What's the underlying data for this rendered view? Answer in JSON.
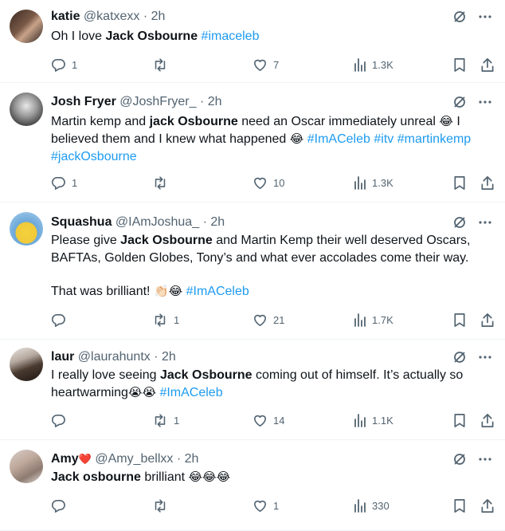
{
  "tweets": [
    {
      "name": "katie",
      "heart": "",
      "handle": "@katxexx",
      "sep": "·",
      "time": "2h",
      "text_a": "Oh I love ",
      "bold_a": "Jack Osbourne",
      "text_b": " ",
      "tags_a": "#imaceleb",
      "replies": "1",
      "reposts": "",
      "likes": "7",
      "views": "1.3K"
    },
    {
      "name": "Josh Fryer",
      "heart": "",
      "handle": "@JoshFryer_",
      "sep": "·",
      "time": "2h",
      "text_a": "Martin kemp and ",
      "bold_a": "jack Osbourne",
      "text_b": " need an Oscar immediately unreal ",
      "emoji_a": "😂",
      "text_c": " I believed them and I knew what happened ",
      "emoji_b": "😂",
      "tags_a": "#ImACeleb",
      "tags_b": "#itv",
      "tags_c": "#martinkemp",
      "tags_d": "#jackOsbourne",
      "replies": "1",
      "reposts": "",
      "likes": "10",
      "views": "1.3K"
    },
    {
      "name": "Squashua",
      "heart": "",
      "handle": "@IAmJoshua_",
      "sep": "·",
      "time": "2h",
      "text_a": "Please give ",
      "bold_a": "Jack Osbourne",
      "text_b": " and Martin Kemp their well deserved Oscars, BAFTAs, Golden Globes, Tony’s and what ever accolades come their way.",
      "text_c": "That was brilliant! ",
      "emoji_a": "👏🏻😂",
      "tags_a": "#ImACeleb",
      "replies": "",
      "reposts": "1",
      "likes": "21",
      "views": "1.7K"
    },
    {
      "name": "laur",
      "heart": "",
      "handle": "@laurahuntx",
      "sep": "·",
      "time": "2h",
      "text_a": "I really love seeing ",
      "bold_a": "Jack Osbourne",
      "text_b": " coming out of himself. It’s actually so heartwarming",
      "emoji_a": "😭😭",
      "tags_a": "#ImACeleb",
      "replies": "",
      "reposts": "1",
      "likes": "14",
      "views": "1.1K"
    },
    {
      "name": "Amy",
      "heart": "❤️",
      "handle": "@Amy_bellxx",
      "sep": "·",
      "time": "2h",
      "bold_a": "Jack osbourne",
      "text_b": " brilliant ",
      "emoji_a": "😂😂😂",
      "replies": "",
      "reposts": "",
      "likes": "1",
      "views": "330"
    }
  ],
  "icons": {
    "grok": "grok-icon",
    "more": "more-icon",
    "reply": "reply-icon",
    "repost": "repost-icon",
    "like": "like-icon",
    "views": "views-icon",
    "bookmark": "bookmark-icon",
    "share": "share-icon"
  },
  "colors": {
    "text": "#0f1419",
    "secondary": "#536471",
    "link": "#1d9bf0",
    "heart": "#e0245e",
    "divider": "#eff3f4"
  }
}
